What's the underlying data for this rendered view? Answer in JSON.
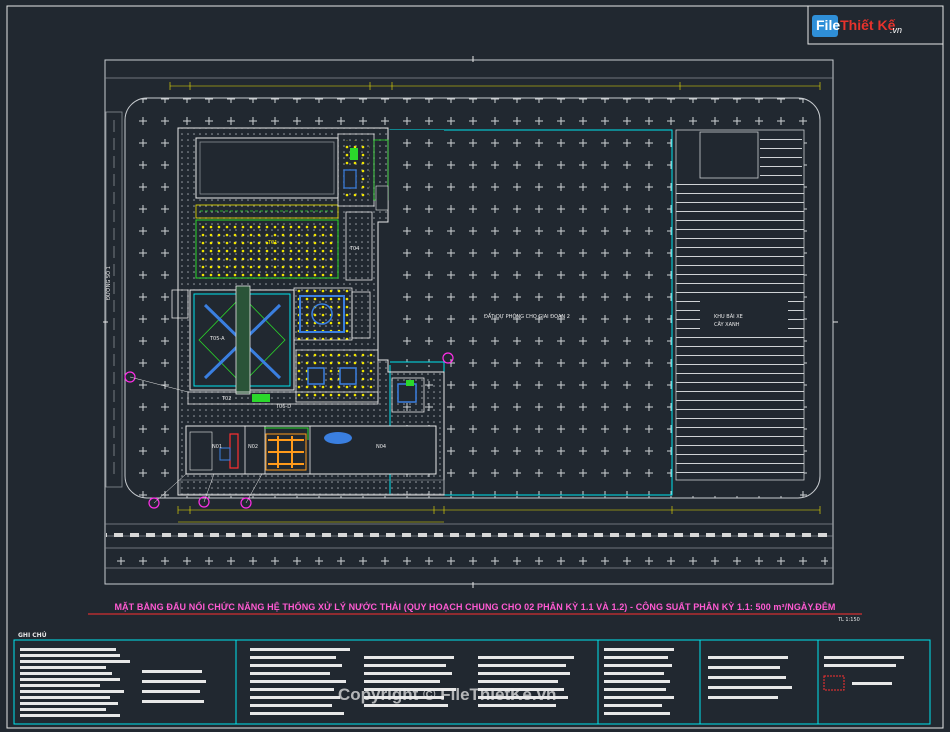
{
  "title": "MẶT BẰNG ĐẤU NỐI CHỨC NĂNG HỆ THỐNG XỬ LÝ NƯỚC THẢI  (QUY HOẠCH CHUNG CHO 02 PHÂN KỲ 1.1 VÀ 1.2) - CÔNG SUẤT PHÂN KỲ 1.1: 500 m³/NGÀY.ĐÊM",
  "scale": "TL 1:150",
  "notes_heading": "GHI CHÚ",
  "logo": {
    "brand_a": "File",
    "brand_b": "Thiết Kế",
    "domain": ".vn"
  },
  "watermark": "Copyright © FileThietKe.vn",
  "units": {
    "t01": "T01",
    "t04": "T04",
    "t05a": "T05-A",
    "n01": "N01",
    "n02": "N02",
    "n04": "N04",
    "t02": "T02",
    "t06": "T06-D",
    "area_right": "ĐẤT DỰ PHÒNG CHO GIAI ĐOẠN 2",
    "area_far": "KHU BÃI XE",
    "area_far2": "CÂY XANH",
    "road_left": "ĐƯỜNG SỐ 1"
  },
  "colors": {
    "bg": "#212830",
    "cyan": "#00e5ee",
    "yellow": "#f2e600",
    "green": "#2bd82b",
    "magenta": "#ff2ee8",
    "white": "#e8e8e8",
    "grey": "#8a8f96",
    "blue": "#3a7fe0",
    "orange": "#ff9a1a",
    "red": "#ff3030"
  }
}
